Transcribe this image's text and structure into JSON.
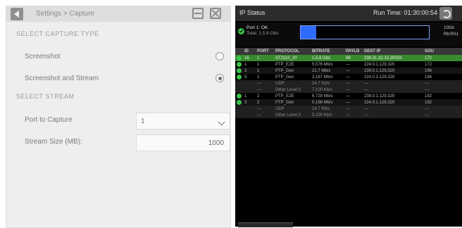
{
  "settings": {
    "breadcrumb": "Settings > Capture",
    "section_capture": "SELECT CAPTURE TYPE",
    "option_screenshot": "Screenshot",
    "option_screenshot_stream": "Screenshot and Stream",
    "selected_option": "Screenshot and Stream",
    "section_stream": "SELECT STREAM",
    "port_label": "Port to Capture",
    "port_value": "1",
    "size_label": "Stream Size (MB):",
    "size_value": "1000"
  },
  "status": {
    "title": "IP Status",
    "run_time": "Run Time: 01:30:00:54",
    "port_line1": "Port 1: OK",
    "port_line2": "Total: 1.5.8 Gbs",
    "gauge_fill_fraction": 0.12,
    "gauge_text": "",
    "side_line1": "10Gb",
    "side_line2": "Rb:RX1",
    "columns": [
      "",
      "ID",
      "PORT",
      "PROTOCOL",
      "BITRATE",
      "PAYLD",
      "DEST IP",
      "SOU"
    ],
    "rows": [
      {
        "kind": "hl",
        "ok": true,
        "cells": [
          "",
          "16",
          "1",
          "ST2110_20",
          "1.5.8 Gbs",
          "96",
          "239.31.32.10.20003",
          "172"
        ]
      },
      {
        "kind": "odd",
        "ok": true,
        "cells": [
          "",
          "1",
          "1",
          "PTP_E2E",
          "5.576 Mb/s",
          "—",
          "224.0.1.129.320",
          "172"
        ]
      },
      {
        "kind": "even",
        "ok": true,
        "cells": [
          "",
          "3",
          "1",
          "PTP_Gen",
          "21.7 Mb/s",
          "—",
          "239.0.1.129.320",
          "196"
        ]
      },
      {
        "kind": "odd",
        "ok": true,
        "cells": [
          "",
          "5",
          "1",
          "PTP_Gen",
          "3.167 Mb/s",
          "—",
          "224.0.1.129.320",
          "196"
        ]
      },
      {
        "kind": "sub",
        "ok": false,
        "cells": [
          "",
          "",
          "—",
          "UDP",
          "24.7 Kb/s",
          "—",
          "—",
          "—"
        ]
      },
      {
        "kind": "sub",
        "ok": false,
        "cells": [
          "",
          "",
          "—",
          "Other Level 3",
          "7.100 Kb/s",
          "—",
          "—",
          "—"
        ]
      },
      {
        "kind": "odd",
        "ok": true,
        "cells": [
          "",
          "1",
          "2",
          "PTP_E2E",
          "6.728 Mb/s",
          "—",
          "239.0.1.129.320",
          "192"
        ]
      },
      {
        "kind": "even",
        "ok": true,
        "cells": [
          "",
          "3",
          "2",
          "PTP_Gen",
          "5.196 Mb/s",
          "—",
          "224.0.1.129.320",
          "192"
        ]
      },
      {
        "kind": "sub",
        "ok": false,
        "cells": [
          "",
          "",
          "—",
          "UDP",
          "24.7 Kb/s",
          "—",
          "—",
          "—"
        ]
      },
      {
        "kind": "sub",
        "ok": false,
        "cells": [
          "",
          "",
          "—",
          "Other Level 3",
          "5.100 Kb/s",
          "—",
          "—",
          "—"
        ]
      }
    ]
  },
  "colors": {
    "accent_green": "#3bc34a",
    "gauge_blue": "#2f6bff",
    "highlight_row": "#3a8a2f"
  }
}
